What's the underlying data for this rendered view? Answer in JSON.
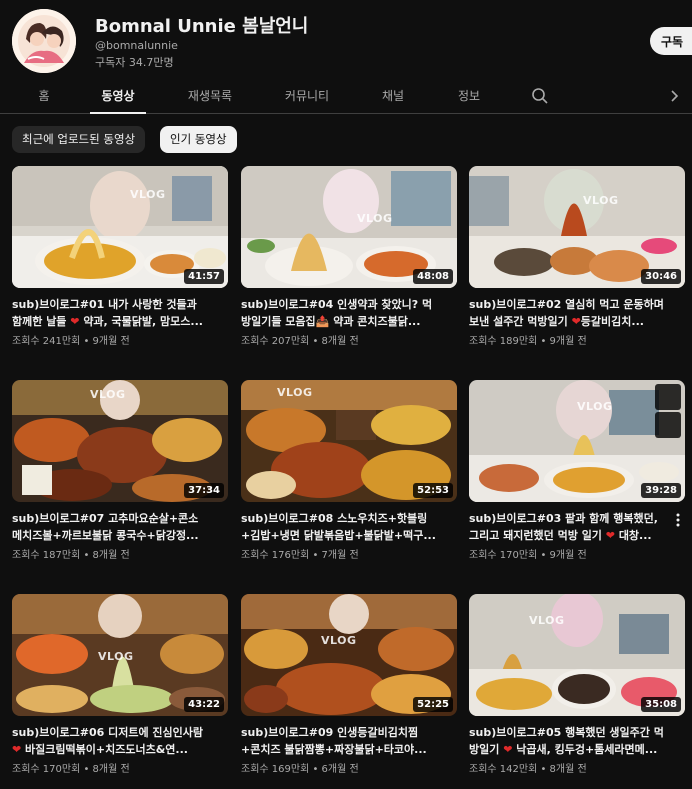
{
  "channel": {
    "name": "Bomnal Unnie 봄날언니",
    "handle": "@bomnalunnie",
    "subscribers": "구독자 34.7만명",
    "subscribe_label": "구독"
  },
  "tabs": [
    {
      "label": "홈",
      "active": false
    },
    {
      "label": "동영상",
      "active": true
    },
    {
      "label": "재생목록",
      "active": false
    },
    {
      "label": "커뮤니티",
      "active": false
    },
    {
      "label": "채널",
      "active": false
    },
    {
      "label": "정보",
      "active": false
    }
  ],
  "icons": {
    "search": "search-icon",
    "next": "chevron-right-icon",
    "more": "more-vert-icon",
    "clock": "clock-icon",
    "queue": "add-to-queue-icon"
  },
  "chips": [
    {
      "label": "최근에 업로드된 동영상",
      "selected": false
    },
    {
      "label": "인기 동영상",
      "selected": true
    }
  ],
  "colors": {
    "background": "#0f0f0f",
    "text": "#f1f1f1",
    "secondary_text": "#aaaaaa",
    "chip": "#272727",
    "heart": "#e02a2a"
  },
  "videos": [
    {
      "duration": "41:57",
      "title_line1": "sub)브이로그#01 내가 사랑한 것들과",
      "title_line2_pre": "함께한 날들 ",
      "title_line2_post": " 약과, 국물닭발, 맘모스...",
      "heart": true,
      "views": "조회수 241만회",
      "age": "9개월 전",
      "overlay": "VLOG"
    },
    {
      "duration": "48:08",
      "title_line1": "sub)브이로그#04 인생약과 찾았니? 먹",
      "title_line2_pre": "방일기들 모음집📤 약과 콘치즈불닭...",
      "title_line2_post": "",
      "heart": false,
      "views": "조회수 207만회",
      "age": "8개월 전",
      "overlay": "VLOG"
    },
    {
      "duration": "30:46",
      "title_line1": "sub)브이로그#02 열심히 먹고 운동하며",
      "title_line2_pre": "보낸 설주간 먹방일기 ",
      "title_line2_post": "등갈비김치...",
      "heart": true,
      "views": "조회수 189만회",
      "age": "9개월 전",
      "overlay": "VLOG"
    },
    {
      "duration": "37:34",
      "title_line1": "sub)브이로그#07 고추마요순살+콘소",
      "title_line2_pre": "메치즈볼+까르보불닭 콩국수+닭강정...",
      "title_line2_post": "",
      "heart": false,
      "views": "조회수 187만회",
      "age": "8개월 전",
      "overlay": "VLOG"
    },
    {
      "duration": "52:53",
      "title_line1": "sub)브이로그#08 스노우치즈+핫블링",
      "title_line2_pre": "+김밥+냉면 닭발볶음밥+불닭발+떡구...",
      "title_line2_post": "",
      "heart": false,
      "views": "조회수 176만회",
      "age": "7개월 전",
      "overlay": "VLOG"
    },
    {
      "duration": "39:28",
      "title_line1": "sub)브이로그#03 팥과 함께 행복했던,",
      "title_line2_pre": "그리고 돼지런했던 먹방 일기 ",
      "title_line2_post": " 대창...",
      "heart": true,
      "views": "조회수 170만회",
      "age": "9개월 전",
      "overlay": "VLOG"
    },
    {
      "duration": "43:22",
      "title_line1": "sub)브이로그#06 디저트에 진심인사람",
      "title_line2_pre": "",
      "title_line2_post": " 바질크림떡볶이+치즈도너츠&연...",
      "heart": true,
      "views": "조회수 170만회",
      "age": "8개월 전",
      "overlay": "VLOG"
    },
    {
      "duration": "52:25",
      "title_line1": "sub)브이로그#09 인생등갈비김치찜",
      "title_line2_pre": "+콘치즈 불닭짬뽕+짜장불닭+타코야...",
      "title_line2_post": "",
      "heart": false,
      "views": "조회수 169만회",
      "age": "6개월 전",
      "overlay": "VLOG"
    },
    {
      "duration": "35:08",
      "title_line1": "sub)브이로그#05 행복했던 생일주간 먹",
      "title_line2_pre": "방일기 ",
      "title_line2_post": " 낙곱새, 킹두겅+톰세라면메...",
      "heart": true,
      "views": "조회수 142만회",
      "age": "8개월 전",
      "overlay": "VLOG"
    }
  ]
}
